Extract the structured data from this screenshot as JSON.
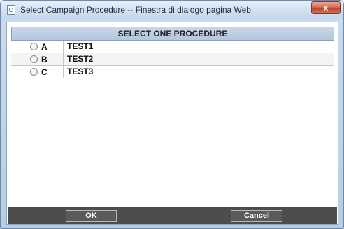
{
  "window": {
    "title": "Select Campaign Procedure -- Finestra di dialogo pagina Web",
    "close_glyph": "x",
    "app_icon": "ie-page-icon"
  },
  "dialog": {
    "header": "SELECT ONE PROCEDURE",
    "procedures": [
      {
        "letter": "A",
        "name": "TEST1",
        "selected": false
      },
      {
        "letter": "B",
        "name": "TEST2",
        "selected": false
      },
      {
        "letter": "C",
        "name": "TEST3",
        "selected": false
      }
    ],
    "ok_label": "OK",
    "cancel_label": "Cancel"
  },
  "colors": {
    "title_bar": "#c9dcef",
    "header_bg": "#b3c7de",
    "footer_bg": "#4d4d4d",
    "close_button": "#c0422b"
  }
}
